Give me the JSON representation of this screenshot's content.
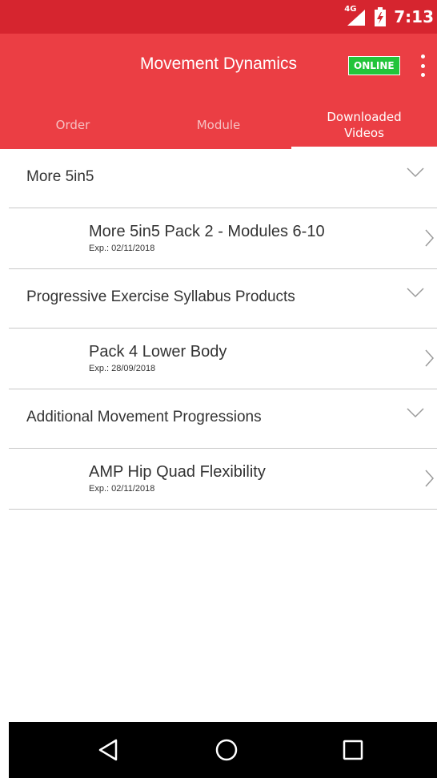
{
  "status_bar": {
    "network": "4G",
    "time": "7:13"
  },
  "app_bar": {
    "title": "Movement Dynamics",
    "online_badge": "ONLINE",
    "overflow_icon": "more-vert-icon"
  },
  "tabs": [
    {
      "label": "Order",
      "active": false
    },
    {
      "label": "Module",
      "active": false
    },
    {
      "label": "Downloaded\nVideos",
      "active": true
    }
  ],
  "groups": [
    {
      "title": "More 5in5",
      "items": [
        {
          "title": "More 5in5 Pack 2 - Modules 6-10",
          "exp": "Exp.: 02/11/2018"
        }
      ]
    },
    {
      "title": "Progressive Exercise Syllabus Products",
      "items": [
        {
          "title": "Pack 4 Lower Body",
          "exp": "Exp.: 28/09/2018"
        }
      ]
    },
    {
      "title": "Additional Movement Progressions",
      "items": [
        {
          "title": "AMP Hip Quad Flexibility",
          "exp": "Exp.: 02/11/2018"
        }
      ]
    }
  ],
  "colors": {
    "status_bar": "#d6252f",
    "app_bar": "#eb3e44",
    "online_green": "#22c43a",
    "nav_bar": "#000000"
  }
}
